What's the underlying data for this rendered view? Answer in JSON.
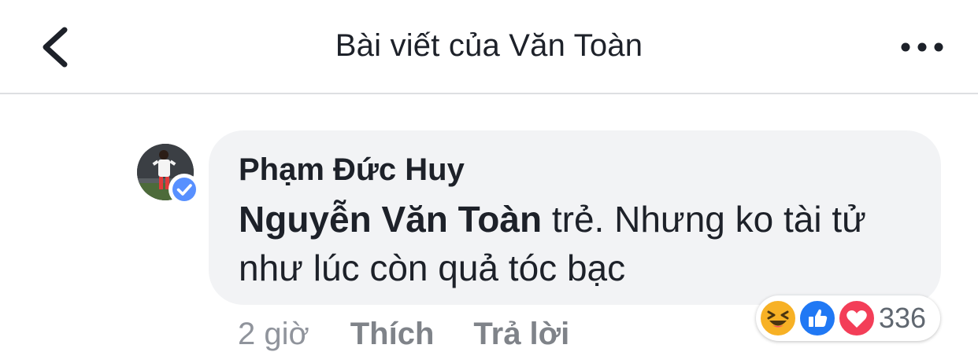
{
  "header": {
    "title": "Bài viết của Văn Toàn",
    "back_icon": "chevron-left-icon",
    "more_icon": "more-horizontal-icon"
  },
  "comment": {
    "author": "Phạm Đức Huy",
    "mention": "Nguyễn Văn Toàn",
    "text": " trẻ. Nhưng ko tài tử như lúc còn quả tóc bạc",
    "time": "2 giờ",
    "like_label": "Thích",
    "reply_label": "Trả lời",
    "reactions": {
      "icons": [
        "haha-icon",
        "like-icon",
        "love-icon"
      ],
      "count": "336"
    }
  },
  "colors": {
    "like": "#2078f4",
    "love": "#f33e58",
    "haha": "#f7b125",
    "bubble": "#f2f3f5",
    "verified": "#5890ff"
  }
}
